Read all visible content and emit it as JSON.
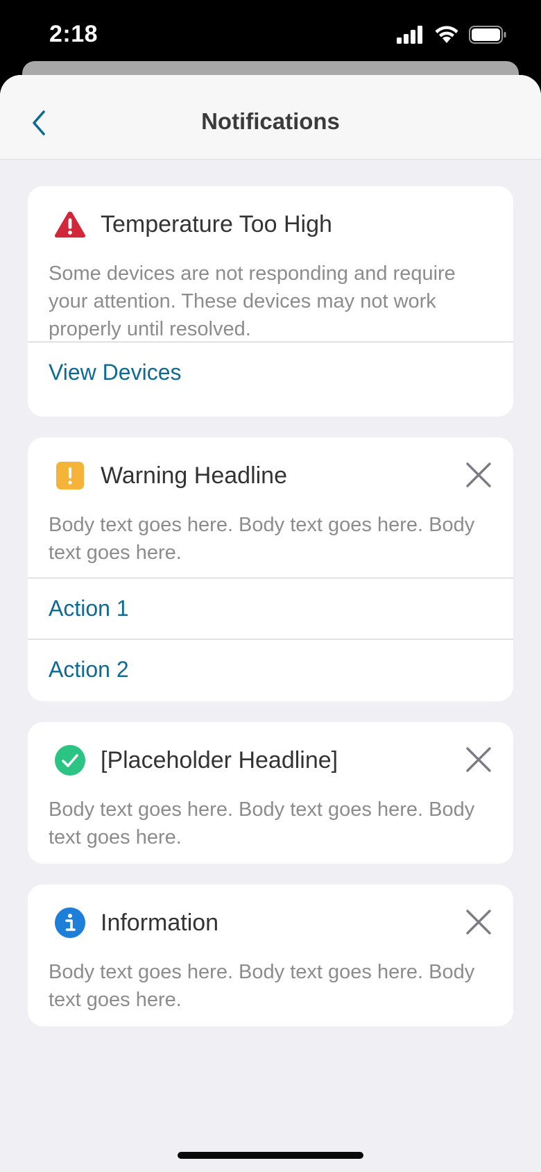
{
  "status_bar": {
    "time": "2:18"
  },
  "nav": {
    "title": "Notifications"
  },
  "colors": {
    "accent": "#0d6a93",
    "error": "#d0283a",
    "warning": "#f5b33a",
    "success": "#2cc485",
    "info": "#1e7fd8"
  },
  "cards": [
    {
      "icon": "error-triangle-icon",
      "title": "Temperature Too High",
      "body": "Some devices are not responding and require your attention. These devices may not work properly until resolved.",
      "actions": [
        "View Devices"
      ]
    },
    {
      "icon": "warning-square-icon",
      "title": "Warning Headline",
      "body": "Body text goes here. Body text goes here. Body text goes here.",
      "dismissible": true,
      "actions": [
        "Action 1",
        "Action 2"
      ]
    },
    {
      "icon": "success-check-icon",
      "title": "[Placeholder Headline]",
      "body": "Body text goes here. Body text goes here. Body text goes here.",
      "dismissible": true
    },
    {
      "icon": "info-icon",
      "title": "Information",
      "body": "Body text goes here. Body text goes here. Body text goes here.",
      "dismissible": true
    }
  ]
}
